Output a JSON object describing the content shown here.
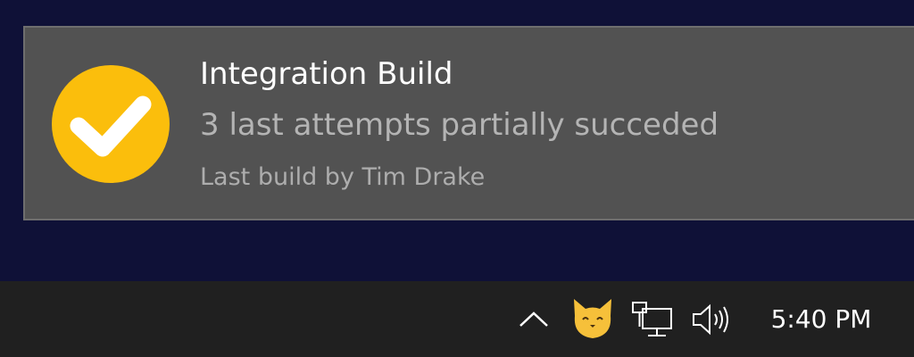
{
  "notification": {
    "title": "Integration Build",
    "message": "3 last attempts partially succeded",
    "attribution": "Last build by Tim Drake",
    "status_icon": "checkmark-circle-icon",
    "status_color": "#fbbe0c"
  },
  "taskbar": {
    "tray_icons": [
      "chevron-up-icon",
      "cat-icon",
      "network-icon",
      "volume-icon"
    ],
    "clock": "5:40 PM"
  },
  "colors": {
    "desktop_background": "#0f1137",
    "toast_background": "#525252",
    "taskbar_background": "#202020"
  }
}
